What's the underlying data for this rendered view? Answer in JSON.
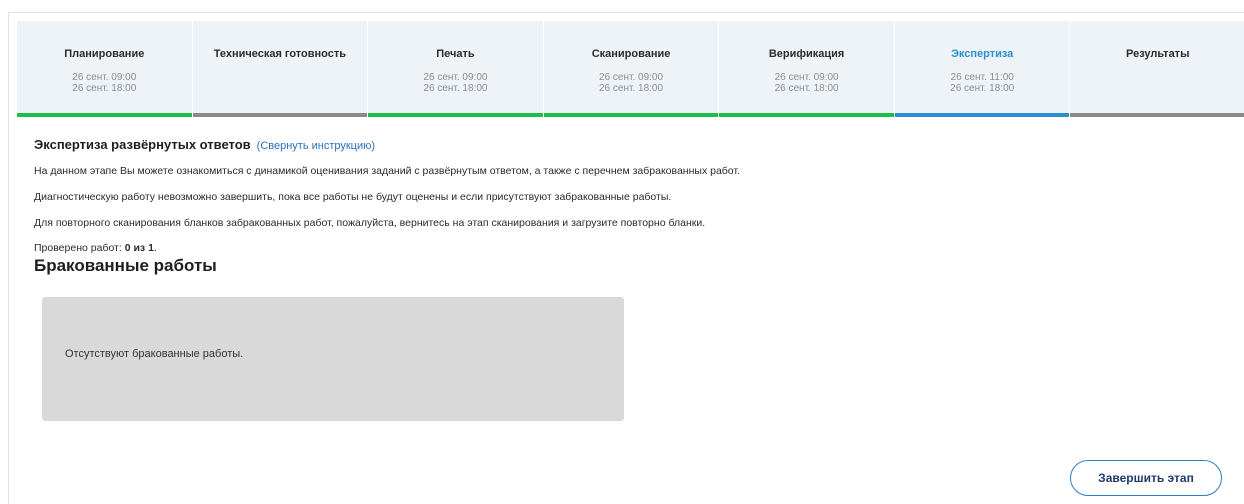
{
  "stages": [
    {
      "name": "Планирование",
      "start": "26 сент. 09:00",
      "end": "26 сент. 18:00",
      "status": "done"
    },
    {
      "name": "Техническая готовность",
      "start": "",
      "end": "",
      "status": "pending"
    },
    {
      "name": "Печать",
      "start": "26 сент. 09:00",
      "end": "26 сент. 18:00",
      "status": "done"
    },
    {
      "name": "Сканирование",
      "start": "26 сент. 09:00",
      "end": "26 сент. 18:00",
      "status": "done"
    },
    {
      "name": "Верификация",
      "start": "26 сент. 09:00",
      "end": "26 сент. 18:00",
      "status": "done"
    },
    {
      "name": "Экспертиза",
      "start": "26 сент. 11:00",
      "end": "26 сент. 18:00",
      "status": "active"
    },
    {
      "name": "Результаты",
      "start": "",
      "end": "",
      "status": "pending"
    }
  ],
  "instruction": {
    "title": "Экспертиза развёрнутых ответов",
    "collapse_link": "(Свернуть инструкцию)",
    "paragraphs": [
      "На данном этапе Вы можете ознакомиться с динамикой оценивания заданий с развёрнутым ответом, а также с перечнем забракованных работ.",
      "Диагностическую работу невозможно завершить, пока все работы не будут оценены и если присутствуют забракованные работы.",
      "Для повторного сканирования бланков забракованных работ, пожалуйста, вернитесь на этап сканирования и загрузите повторно бланки."
    ]
  },
  "checked": {
    "label": "Проверено работ: ",
    "value": "0 из 1",
    "suffix": "."
  },
  "rejected": {
    "title": "Бракованные работы",
    "empty_text": "Отсутствуют бракованные работы."
  },
  "finish_button": "Завершить этап",
  "colors": {
    "done": "#1fbe4a",
    "pending": "#8a8a8a",
    "active": "#2a8fd0",
    "active_text": "#2c8fd0",
    "link": "#2b6fbf"
  }
}
